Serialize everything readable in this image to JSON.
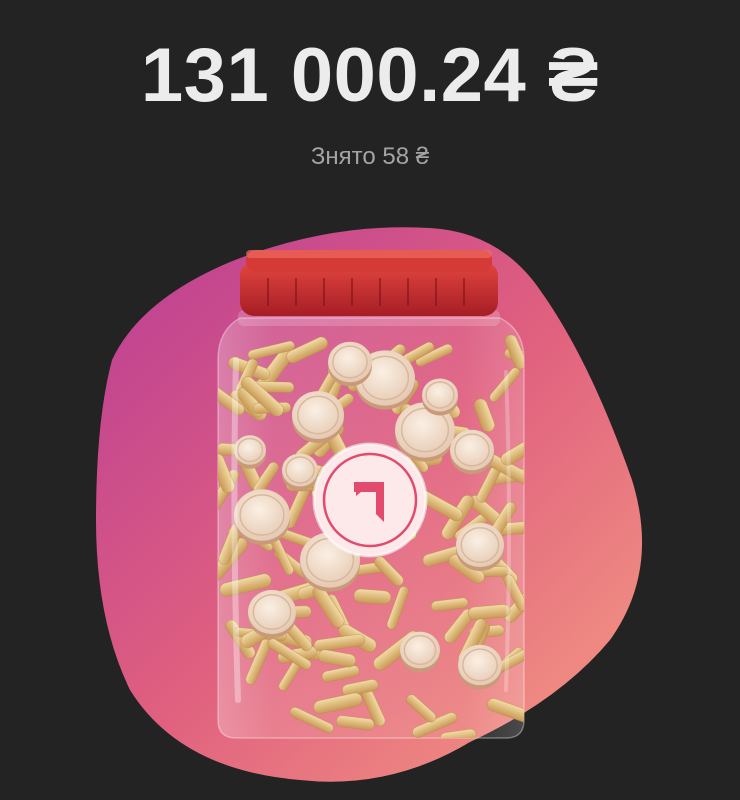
{
  "jar": {
    "balance": "131 000.24 ₴",
    "withdrawn": "Знято 58 ₴"
  },
  "colors": {
    "background": "#232323",
    "blob_start": "#c9478f",
    "blob_end": "#f2907f",
    "lid": "#c42a2e",
    "logo_accent": "#e24a6e"
  },
  "icons": {
    "logo": "jar-logo-icon"
  }
}
